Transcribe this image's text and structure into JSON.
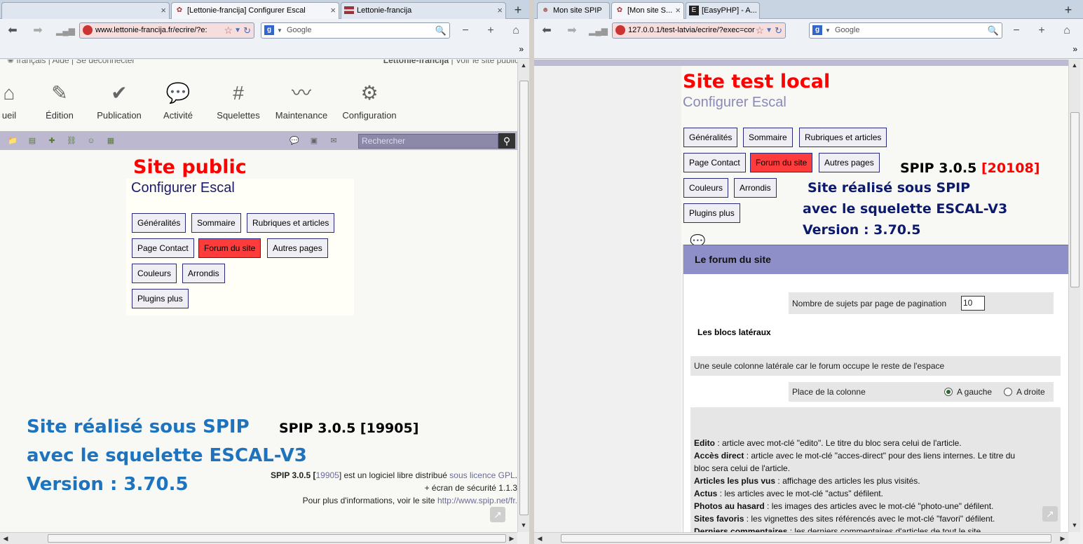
{
  "left_window": {
    "tabs": [
      {
        "label": "",
        "favicon": ""
      },
      {
        "label": "[Lettonie-francija] Configurer Escal",
        "favicon": "spip"
      },
      {
        "label": "Lettonie-francija",
        "favicon": "flag"
      }
    ],
    "url": "www.lettonie-francija.fr/ecrire/?e:",
    "search_placeholder": "Google",
    "page": {
      "topline_left": "français | Aide | Se déconnecter",
      "topline_site": "Lettonie-francija",
      "topline_right": " | Voir le site public",
      "menu": [
        "ueil",
        "Édition",
        "Publication",
        "Activité",
        "Squelettes",
        "Maintenance",
        "Configuration"
      ],
      "search_placeholder": "Rechercher",
      "annotation_title": "Site public",
      "panel_title": "Configurer Escal",
      "buttons": [
        [
          "Généralités",
          "Sommaire",
          "Rubriques et articles"
        ],
        [
          "Page Contact",
          "Forum du site",
          "Autres pages"
        ],
        [
          "Couleurs",
          "Arrondis"
        ],
        [
          "Plugins plus"
        ]
      ],
      "active_button": "Forum du site",
      "blue_line1": "Site réalisé sous SPIP",
      "blue_line2": "avec le squelette ESCAL-V3",
      "blue_line3": "Version : 3.70.5",
      "spip_version_black": "SPIP 3.0.5 [19905]",
      "footer_line1_a": "SPIP 3.0.5 [",
      "footer_line1_b": "19905",
      "footer_line1_c": "] est un logiciel libre distribué ",
      "footer_line1_link": "sous licence GPL",
      "footer_line1_end": ".",
      "footer_line2": "+ écran de sécurité 1.1.3",
      "footer_line3": "Pour plus d'informations, voir le site ",
      "footer_line3_link": "http://www.spip.net/fr."
    }
  },
  "right_window": {
    "tabs": [
      {
        "label": "Mon site SPIP",
        "favicon": "person"
      },
      {
        "label": "[Mon site S...",
        "favicon": "spip"
      },
      {
        "label": "[EasyPHP] - A...",
        "favicon": "easyphp"
      }
    ],
    "url": "127.0.0.1/test-latvia/ecrire/?exec=cor",
    "search_placeholder": "Google",
    "page": {
      "annotation_title": "Site test local",
      "panel_title": "Configurer Escal",
      "buttons": [
        [
          "Généralités",
          "Sommaire",
          "Rubriques et articles"
        ],
        [
          "Page Contact",
          "Forum du site",
          "Autres pages"
        ],
        [
          "Couleurs",
          "Arrondis"
        ],
        [
          "Plugins plus"
        ]
      ],
      "active_button": "Forum du site",
      "spip_version_prefix": "SPIP 3.0.5 ",
      "spip_version_build": "[20108]",
      "navy_line1": "Site réalisé sous SPIP",
      "navy_line2": "avec le squelette ESCAL-V3",
      "navy_line3": "Version : 3.70.5",
      "forum_title": "Le forum du site",
      "pagination_label": "Nombre de sujets par page de pagination",
      "pagination_value": "10",
      "blocks_title": "Les blocs latéraux",
      "one_column_text": "Une seule colonne latérale car le forum occupe le reste de l'espace",
      "column_place_label": "Place de la colonne",
      "radio_left": "A gauche",
      "radio_right": "A droite",
      "descriptions": [
        {
          "term": "Edito",
          "text": " : article avec mot-clé \"edito\". Le titre du bloc sera celui de l'article."
        },
        {
          "term": "Accès direct",
          "text": " : article avec le mot-clé \"acces-direct\" pour des liens internes. Le titre du"
        },
        {
          "term": "",
          "text": "bloc sera celui de l'article."
        },
        {
          "term": "Articles les plus vus",
          "text": " : affichage des articles les plus visités."
        },
        {
          "term": "Actus",
          "text": " : les articles avec le mot-clé \"actus\" défilent."
        },
        {
          "term": "Photos au hasard",
          "text": " : les images des articles avec le mot-clé \"photo-une\" défilent."
        },
        {
          "term": "Sites favoris",
          "text": " : les vignettes des sites référencés avec le mot-clé \"favori\" défilent."
        },
        {
          "term": "Derniers commentaires",
          "text": " : les derniers commentaires d'articles de tout le site"
        }
      ]
    }
  },
  "colors": {
    "active_button": "#ff3c3c",
    "annotation_red": "#ff0000",
    "annotation_blue": "#1e73be",
    "forum_header": "#8e8ec8",
    "spip_toolbar": "#bbb8d0"
  }
}
